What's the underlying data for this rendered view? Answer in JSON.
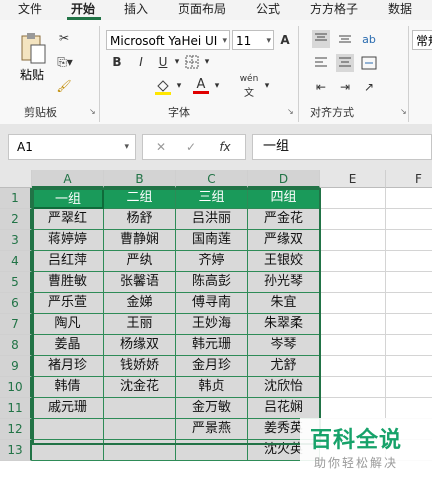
{
  "ribbon_tabs": [
    "文件",
    "开始",
    "插入",
    "页面布局",
    "公式",
    "方方格子",
    "数据"
  ],
  "active_tab": "开始",
  "clipboard": {
    "paste_label": "粘贴",
    "group_label": "剪贴板"
  },
  "font": {
    "name": "Microsoft YaHei UI",
    "size": "11",
    "group_label": "字体",
    "bold": "B",
    "italic": "I",
    "underline": "U",
    "grow": "A",
    "shrink": "A",
    "font_color_letter": "A",
    "phonetic": "wén"
  },
  "alignment": {
    "group_label": "对齐方式",
    "wrap_text": "ab"
  },
  "number": {
    "format_partial": "常规"
  },
  "formula_bar": {
    "name_box": "A1",
    "fx": "fx",
    "content": "一组"
  },
  "sheet": {
    "columns": [
      "A",
      "B",
      "C",
      "D",
      "E",
      "F"
    ],
    "rows": [
      "1",
      "2",
      "3",
      "4",
      "5",
      "6",
      "7",
      "8",
      "9",
      "10",
      "11",
      "12",
      "13"
    ],
    "data": [
      [
        "一组",
        "二组",
        "三组",
        "四组"
      ],
      [
        "严翠红",
        "杨舒",
        "吕洪丽",
        "严金花"
      ],
      [
        "蒋婷婷",
        "曹静娴",
        "国南莲",
        "严缘双"
      ],
      [
        "吕红萍",
        "严纨",
        "齐婷",
        "王银姣"
      ],
      [
        "曹胜敏",
        "张馨语",
        "陈高彭",
        "孙光琴"
      ],
      [
        "严乐萱",
        "金娣",
        "傅寻南",
        "朱宜"
      ],
      [
        "陶凡",
        "王丽",
        "王妙海",
        "朱翠柔"
      ],
      [
        "姜晶",
        "杨缘双",
        "韩元珊",
        "岑琴"
      ],
      [
        "褚月珍",
        "钱娇娇",
        "金月珍",
        "尤舒"
      ],
      [
        "韩倩",
        "沈金花",
        "韩贞",
        "沈欣怡"
      ],
      [
        "戚元珊",
        "",
        "金万敏",
        "吕花娴"
      ],
      [
        "",
        "",
        "严景燕",
        "姜秀英"
      ],
      [
        "",
        "",
        "",
        "沈火英"
      ]
    ]
  },
  "watermark": {
    "title": "百科全说",
    "subtitle": "助你轻松解决"
  },
  "colors": {
    "excel_green": "#217346",
    "header_fill": "#1a9a5a",
    "data_fill": "#d9d9d9"
  }
}
